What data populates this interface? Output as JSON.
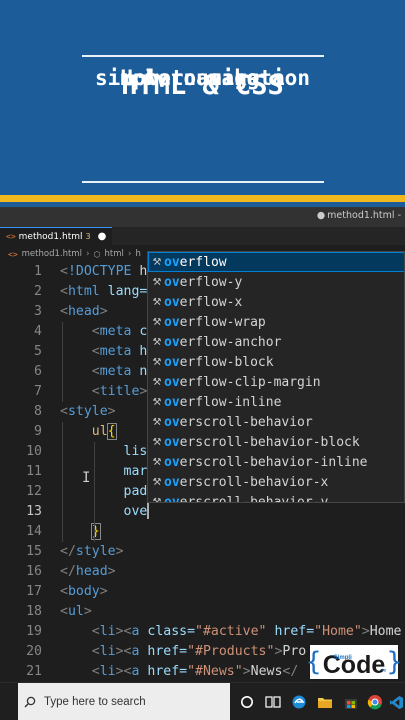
{
  "banner": {
    "title_lines": [
      "How to make a",
      "simple navigation",
      "bar using",
      "HTML & CSS"
    ]
  },
  "window": {
    "title_file": "method1.html -"
  },
  "tab": {
    "label": "method1.html",
    "badge": "3",
    "icon": "html-file-icon"
  },
  "breadcrumb": {
    "file": "method1.html",
    "element": "html",
    "next": "h"
  },
  "editor": {
    "active_line": 13,
    "lines": [
      {
        "n": "1",
        "indent": "",
        "parts": [
          [
            "punc",
            "<"
          ],
          [
            "tag",
            "!DOCTYPE"
          ],
          [
            "text",
            " h"
          ]
        ]
      },
      {
        "n": "2",
        "indent": "",
        "parts": [
          [
            "punc",
            "<"
          ],
          [
            "tag",
            "html"
          ],
          [
            "attr",
            " lang="
          ]
        ]
      },
      {
        "n": "3",
        "indent": "",
        "parts": [
          [
            "punc",
            "<"
          ],
          [
            "tag",
            "head"
          ],
          [
            "punc",
            ">"
          ]
        ]
      },
      {
        "n": "4",
        "indent": "    ",
        "parts": [
          [
            "punc",
            "<"
          ],
          [
            "tag",
            "meta"
          ],
          [
            "attr",
            " c"
          ]
        ]
      },
      {
        "n": "5",
        "indent": "    ",
        "parts": [
          [
            "punc",
            "<"
          ],
          [
            "tag",
            "meta"
          ],
          [
            "attr",
            " h"
          ]
        ]
      },
      {
        "n": "6",
        "indent": "    ",
        "parts": [
          [
            "punc",
            "<"
          ],
          [
            "tag",
            "meta"
          ],
          [
            "attr",
            " n"
          ]
        ]
      },
      {
        "n": "7",
        "indent": "    ",
        "parts": [
          [
            "punc",
            "<"
          ],
          [
            "tag",
            "title"
          ],
          [
            "punc",
            ">"
          ]
        ]
      },
      {
        "n": "8",
        "indent": "",
        "parts": [
          [
            "punc",
            "<"
          ],
          [
            "tag",
            "style"
          ],
          [
            "punc",
            ">"
          ]
        ]
      },
      {
        "n": "9",
        "indent": "    ",
        "parts": [
          [
            "sel",
            "ul"
          ],
          [
            "brace",
            "{"
          ]
        ]
      },
      {
        "n": "10",
        "indent": "        ",
        "parts": [
          [
            "attr",
            "lis"
          ]
        ]
      },
      {
        "n": "11",
        "indent": "        ",
        "parts": [
          [
            "attr",
            "mar"
          ]
        ]
      },
      {
        "n": "12",
        "indent": "        ",
        "parts": [
          [
            "attr",
            "pad"
          ]
        ]
      },
      {
        "n": "13",
        "indent": "        ",
        "parts": [
          [
            "attr",
            "ove"
          ]
        ]
      },
      {
        "n": "14",
        "indent": "    ",
        "parts": [
          [
            "brace",
            "}"
          ]
        ]
      },
      {
        "n": "15",
        "indent": "",
        "parts": [
          [
            "punc",
            "</"
          ],
          [
            "tag",
            "style"
          ],
          [
            "punc",
            ">"
          ]
        ]
      },
      {
        "n": "16",
        "indent": "",
        "parts": [
          [
            "punc",
            "</"
          ],
          [
            "tag",
            "head"
          ],
          [
            "punc",
            ">"
          ]
        ]
      },
      {
        "n": "17",
        "indent": "",
        "parts": [
          [
            "punc",
            "<"
          ],
          [
            "tag",
            "body"
          ],
          [
            "punc",
            ">"
          ]
        ]
      },
      {
        "n": "18",
        "indent": "",
        "parts": [
          [
            "punc",
            "<"
          ],
          [
            "tag",
            "ul"
          ],
          [
            "punc",
            ">"
          ]
        ]
      },
      {
        "n": "19",
        "indent": "    ",
        "parts": [
          [
            "punc",
            "<"
          ],
          [
            "tag",
            "li"
          ],
          [
            "punc",
            "><"
          ],
          [
            "tag",
            "a"
          ],
          [
            "attr",
            " class="
          ],
          [
            "str",
            "\"#active\""
          ],
          [
            "attr",
            " href="
          ],
          [
            "str",
            "\"Home\""
          ],
          [
            "punc",
            ">"
          ],
          [
            "text",
            "Home"
          ]
        ]
      },
      {
        "n": "20",
        "indent": "    ",
        "parts": [
          [
            "punc",
            "<"
          ],
          [
            "tag",
            "li"
          ],
          [
            "punc",
            "><"
          ],
          [
            "tag",
            "a"
          ],
          [
            "attr",
            " href="
          ],
          [
            "str",
            "\"#Products\""
          ],
          [
            "punc",
            ">"
          ],
          [
            "text",
            "Pro"
          ]
        ]
      },
      {
        "n": "21",
        "indent": "    ",
        "parts": [
          [
            "punc",
            "<"
          ],
          [
            "tag",
            "li"
          ],
          [
            "punc",
            "><"
          ],
          [
            "tag",
            "a"
          ],
          [
            "attr",
            " href="
          ],
          [
            "str",
            "\"#News\""
          ],
          [
            "punc",
            ">"
          ],
          [
            "text",
            "News"
          ],
          [
            "punc",
            "</"
          ]
        ]
      }
    ]
  },
  "suggest": {
    "typed": "ov",
    "selected_index": 0,
    "items": [
      {
        "match": "ov",
        "rest": "erflow"
      },
      {
        "match": "ov",
        "rest": "erflow-y"
      },
      {
        "match": "ov",
        "rest": "erflow-x"
      },
      {
        "match": "ov",
        "rest": "erflow-wrap"
      },
      {
        "match": "ov",
        "rest": "erflow-anchor"
      },
      {
        "match": "ov",
        "rest": "erflow-block"
      },
      {
        "match": "ov",
        "rest": "erflow-clip-margin"
      },
      {
        "match": "ov",
        "rest": "erflow-inline"
      },
      {
        "match": "ov",
        "rest": "erscroll-behavior"
      },
      {
        "match": "ov",
        "rest": "erscroll-behavior-block"
      },
      {
        "match": "ov",
        "rest": "erscroll-behavior-inline"
      },
      {
        "match": "ov",
        "rest": "erscroll-behavior-x"
      },
      {
        "match": "ov",
        "rest": "erscroll-behavior-y"
      }
    ],
    "item_icon": "wrench-icon"
  },
  "logo": {
    "word": "Code",
    "small_top": "Simpli",
    "small_bottom": "by",
    "brace_left": "{",
    "brace_right": "}"
  },
  "taskbar": {
    "search_placeholder": "Type here to search",
    "icons": [
      "windows-start-icon",
      "search-icon",
      "cortana-icon",
      "task-view-icon",
      "edge-icon",
      "folder-icon",
      "store-icon",
      "chrome-icon",
      "vscode-icon"
    ]
  },
  "colors": {
    "banner_blue": "#1b5c99",
    "banner_yellow": "#f2b91e",
    "editor_bg": "#1e1e1e",
    "suggest_bg": "#252526",
    "suggest_selected": "#04395e",
    "match_blue": "#18a3ff"
  }
}
